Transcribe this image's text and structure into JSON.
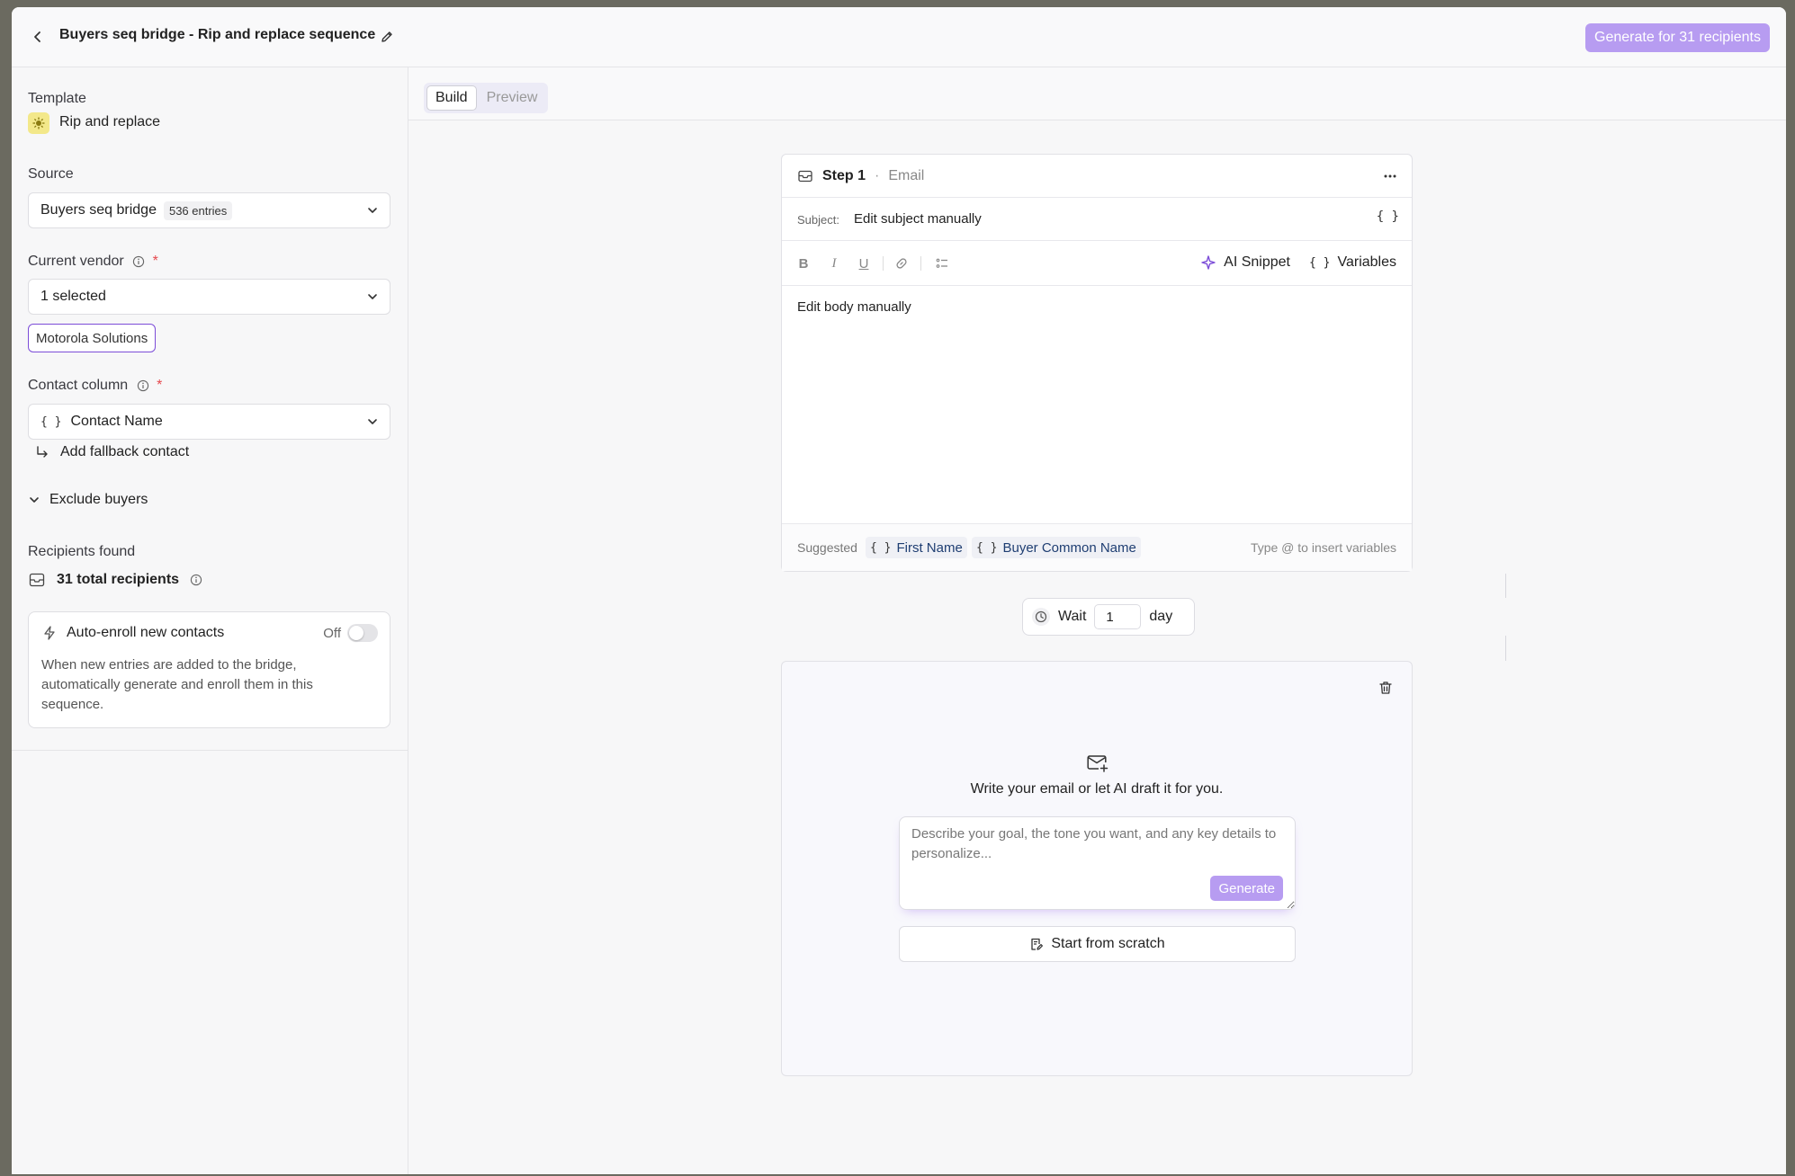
{
  "header": {
    "title": "Buyers seq bridge - Rip and replace sequence",
    "generate_label": "Generate for 31 recipients"
  },
  "sidebar": {
    "template_label": "Template",
    "template_name": "Rip and replace",
    "source_label": "Source",
    "source_value": "Buyers seq bridge",
    "source_badge": "536 entries",
    "vendor_label": "Current vendor",
    "vendor_value": "1 selected",
    "vendor_chip": "Motorola Solutions",
    "contact_label": "Contact column",
    "contact_value": "Contact Name",
    "fallback_label": "Add fallback contact",
    "exclude_label": "Exclude buyers",
    "recipients_label": "Recipients found",
    "recipients_count": "31 total recipients",
    "required_mark": "*",
    "auto_enroll": {
      "title": "Auto-enroll new contacts",
      "state": "Off",
      "enabled": false,
      "description": "When new entries are added to the bridge, automatically generate and enroll them in this sequence."
    }
  },
  "tabs": [
    {
      "label": "Build",
      "active": true
    },
    {
      "label": "Preview",
      "active": false
    }
  ],
  "step1": {
    "title": "Step 1",
    "separator": "·",
    "type": "Email",
    "subject_label": "Subject:",
    "subject_value": "Edit subject manually",
    "braces": "{ }",
    "toolbar": {
      "bold": "B",
      "italic": "I",
      "underline": "U",
      "ai_snippet": "AI Snippet",
      "variables": "Variables"
    },
    "body": "Edit body manually",
    "suggested_label": "Suggested",
    "suggested": [
      "First Name",
      "Buyer Common Name"
    ],
    "hint": "Type @ to insert variables"
  },
  "wait": {
    "label": "Wait",
    "value": "1",
    "unit": "day"
  },
  "step2": {
    "prompt_heading": "Write your email or let AI draft it for you.",
    "prompt_placeholder": "Describe your goal, the tone you want, and any key details to personalize...",
    "generate_label": "Generate",
    "scratch_label": "Start from scratch"
  },
  "colors": {
    "accent": "#b79cf1",
    "chip_border": "#7c4dd8",
    "required": "#e5484d"
  }
}
